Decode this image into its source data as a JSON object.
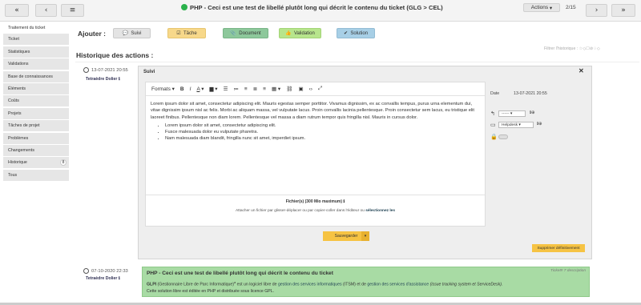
{
  "header": {
    "title": "PHP - Ceci est une test de libellé plutôt long qui décrit le contenu du ticket (GLG > CEL)",
    "actions_label": "Actions",
    "pager": "2/15",
    "status_color": "#2bb24c"
  },
  "sidebar": {
    "items": [
      {
        "label": "Traitement du ticket"
      },
      {
        "label": "Ticket"
      },
      {
        "label": "Statistiques"
      },
      {
        "label": "Validations"
      },
      {
        "label": "Base de connaissances"
      },
      {
        "label": "Éléments"
      },
      {
        "label": "Coûts"
      },
      {
        "label": "Projets"
      },
      {
        "label": "Tâches de projet"
      },
      {
        "label": "Problèmes"
      },
      {
        "label": "Changements"
      },
      {
        "label": "Historique",
        "badge": "8"
      },
      {
        "label": "Tous"
      }
    ]
  },
  "add": {
    "label": "Ajouter :",
    "buttons": [
      {
        "label": "Suivi",
        "color": "#e4e4e4"
      },
      {
        "label": "Tâche",
        "color": "#f7d88a"
      },
      {
        "label": "Document",
        "color": "#8dc89b"
      },
      {
        "label": "Validation",
        "color": "#b7e58c"
      },
      {
        "label": "Solution",
        "color": "#a7cfe6"
      }
    ]
  },
  "history": {
    "title": "Historique des actions :",
    "filter": "Filtrer l'historique :",
    "entry1": {
      "date": "13-07-2021 20:55",
      "author": "Tetraèdre Dolier"
    },
    "entry2": {
      "date": "07-10-2020 22:33",
      "author": "Tetraèdre Dolier"
    }
  },
  "followup": {
    "heading": "Suivi",
    "date_label": "Date",
    "date_value": "13-07-2021 20:55",
    "toolbar_formats": "Formats",
    "paragraph": "Lorem ipsum dolor sit amet, consectetur adipiscing elit. Mauris egestas semper porttitor. Vivamus dignissim, ex ac convallis tempus, purus urna elementum dui, vitae dignissim ipsum nisl ac felis. Morbi ac aliquam massa, vel vulputate lacus. Proin convallis lacinia pellentesque. Proin consectetur sem lacus, eu tristique elit laoreet finibus. Pellentesque non diam lorem. Pellentesque vel massa a diam rutrum tempor quis fringilla nisl. Mauris in cursus dolor.",
    "bullets": [
      "Lorem ipsum dolor sit amet, consectetur adipiscing elit.",
      "Fusce malesuada dolor eu vulputate pharetra.",
      "Nam malesuada diam blandit, fringilla nunc sit amet, imperdiet ipsum."
    ],
    "files_label": "Fichier(s) (300 Mio maximum)",
    "attach_text": "Attacher un fichier par glisser-déplacer ou par copier-coller dans l'éditeur ou",
    "attach_link": "sélectionnez les",
    "save_label": "Sauvegarder",
    "delete_label": "Supprimer définitivement",
    "source_value": "------",
    "group_value": "Helpdesk"
  },
  "ticket": {
    "tag": "Ticket# 7 description",
    "title": "PHP - Ceci est une test de libellé plutôt long qui décrit le contenu du ticket",
    "text1": "GLPI",
    "text2": " (Gestionnaire Libre de Parc Informatique)",
    "text3": " est un logiciel libre de ",
    "link1": "gestion des services informatiques",
    "text4": " (ITSM) et de ",
    "link2": "gestion des services d'assistance",
    "text5": " (issue tracking system et ServiceDesk).",
    "text6": "Cette solution libre est éditée en PHP et distribuée sous licence GPL."
  }
}
